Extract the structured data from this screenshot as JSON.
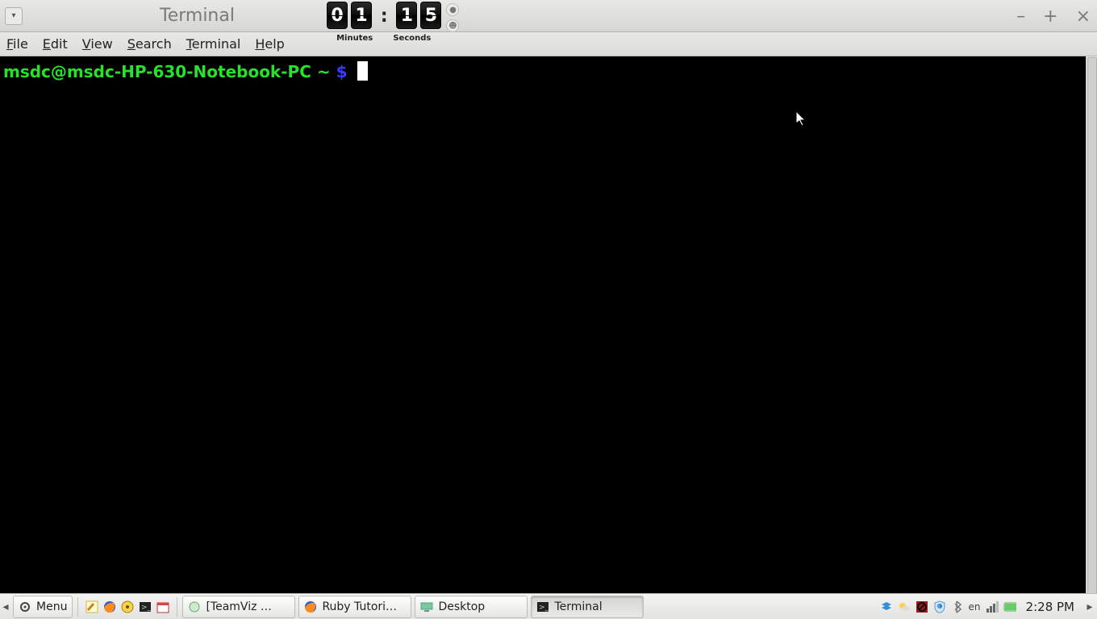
{
  "window": {
    "title": "Terminal",
    "minimize": "–",
    "maximize": "+",
    "close": "×"
  },
  "timer": {
    "minutes": [
      "0",
      "1"
    ],
    "seconds": [
      "1",
      "5"
    ],
    "minutes_label": "Minutes",
    "seconds_label": "Seconds"
  },
  "menu": {
    "file": "File",
    "edit": "Edit",
    "view": "View",
    "search": "Search",
    "terminal": "Terminal",
    "help": "Help"
  },
  "prompt": {
    "userhost": "msdc@msdc-HP-630-Notebook-PC",
    "path": "~",
    "symbol": "$"
  },
  "panel": {
    "menu_label": "Menu",
    "tasks": [
      {
        "label": "[TeamViz …"
      },
      {
        "label": "Ruby Tutori…"
      },
      {
        "label": "Desktop"
      },
      {
        "label": "Terminal"
      }
    ],
    "lang": "en",
    "clock": "2:28 PM"
  }
}
